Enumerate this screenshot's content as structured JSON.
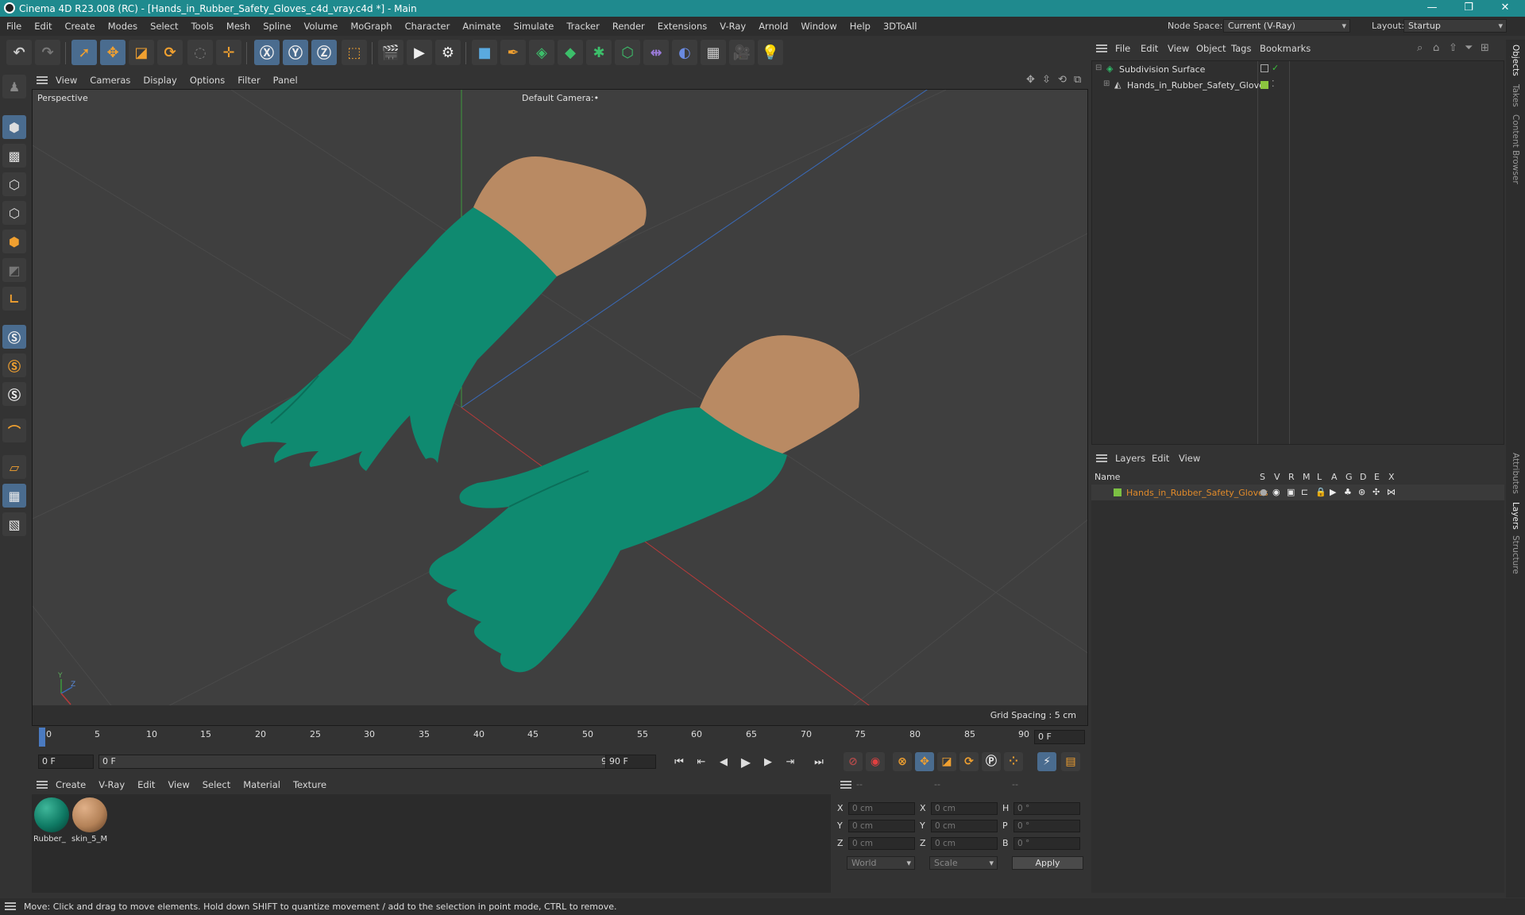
{
  "window": {
    "title": "Cinema 4D R23.008 (RC) - [Hands_in_Rubber_Safety_Gloves_c4d_vray.c4d *] - Main",
    "controls": [
      "—",
      "❐",
      "✕"
    ]
  },
  "menubar": {
    "items": [
      "File",
      "Edit",
      "Create",
      "Modes",
      "Select",
      "Tools",
      "Mesh",
      "Spline",
      "Volume",
      "MoGraph",
      "Character",
      "Animate",
      "Simulate",
      "Tracker",
      "Render",
      "Extensions",
      "V-Ray",
      "Arnold",
      "Window",
      "Help",
      "3DToAll"
    ],
    "node_space_label": "Node Space:",
    "node_space_value": "Current (V-Ray)",
    "layout_label": "Layout:",
    "layout_value": "Startup"
  },
  "viewport": {
    "menu": [
      "View",
      "Cameras",
      "Display",
      "Options",
      "Filter",
      "Panel"
    ],
    "view_name": "Perspective",
    "camera": "Default Camera",
    "camera_suffix": ":•",
    "grid_spacing": "Grid Spacing : 5 cm",
    "axis_y": "Y",
    "axis_z": "Z",
    "axis_x": "X"
  },
  "timeline": {
    "ticks": [
      "0",
      "5",
      "10",
      "15",
      "20",
      "25",
      "30",
      "35",
      "40",
      "45",
      "50",
      "55",
      "60",
      "65",
      "70",
      "75",
      "80",
      "85",
      "90"
    ],
    "current_frame": "0 F"
  },
  "transport": {
    "start": "0 F",
    "range_start": "0 F",
    "range_end": "90 F",
    "end": "90 F"
  },
  "materials": {
    "menu": [
      "Create",
      "V-Ray",
      "Edit",
      "View",
      "Select",
      "Material",
      "Texture"
    ],
    "items": [
      {
        "name": "Rubber_",
        "color": "#0f7a64"
      },
      {
        "name": "skin_5_M",
        "color": "#b48258"
      }
    ]
  },
  "coordinates": {
    "headers": [
      "--",
      "--",
      "--"
    ],
    "rows": [
      {
        "a": "X",
        "av": "0 cm",
        "b": "X",
        "bv": "0 cm",
        "c": "H",
        "cv": "0 °"
      },
      {
        "a": "Y",
        "av": "0 cm",
        "b": "Y",
        "bv": "0 cm",
        "c": "P",
        "cv": "0 °"
      },
      {
        "a": "Z",
        "av": "0 cm",
        "b": "Z",
        "bv": "0 cm",
        "c": "B",
        "cv": "0 °"
      }
    ],
    "space": "World",
    "mode": "Scale",
    "apply": "Apply"
  },
  "objects": {
    "menu": [
      "File",
      "Edit",
      "View",
      "Object",
      "Tags",
      "Bookmarks"
    ],
    "tree": [
      {
        "name": "Subdivision Surface",
        "color": "#2fbf6a"
      },
      {
        "name": "Hands_in_Rubber_Safety_Gloves",
        "color": "#8cc63f"
      }
    ]
  },
  "layers": {
    "menu": [
      "Layers",
      "Edit",
      "View"
    ],
    "columns": [
      "Name",
      "S",
      "V",
      "R",
      "M",
      "L",
      "A",
      "G",
      "D",
      "E",
      "X"
    ],
    "items": [
      {
        "name": "Hands_in_Rubber_Safety_Gloves",
        "color": "#7cc043",
        "name_color": "#e08a2a"
      }
    ]
  },
  "side_tabs": [
    "Objects",
    "Takes",
    "Content Browser",
    "Attributes",
    "Layers",
    "Structure"
  ],
  "status": "Move: Click and drag to move elements. Hold down SHIFT to quantize movement / add to the selection in point mode, CTRL to remove."
}
